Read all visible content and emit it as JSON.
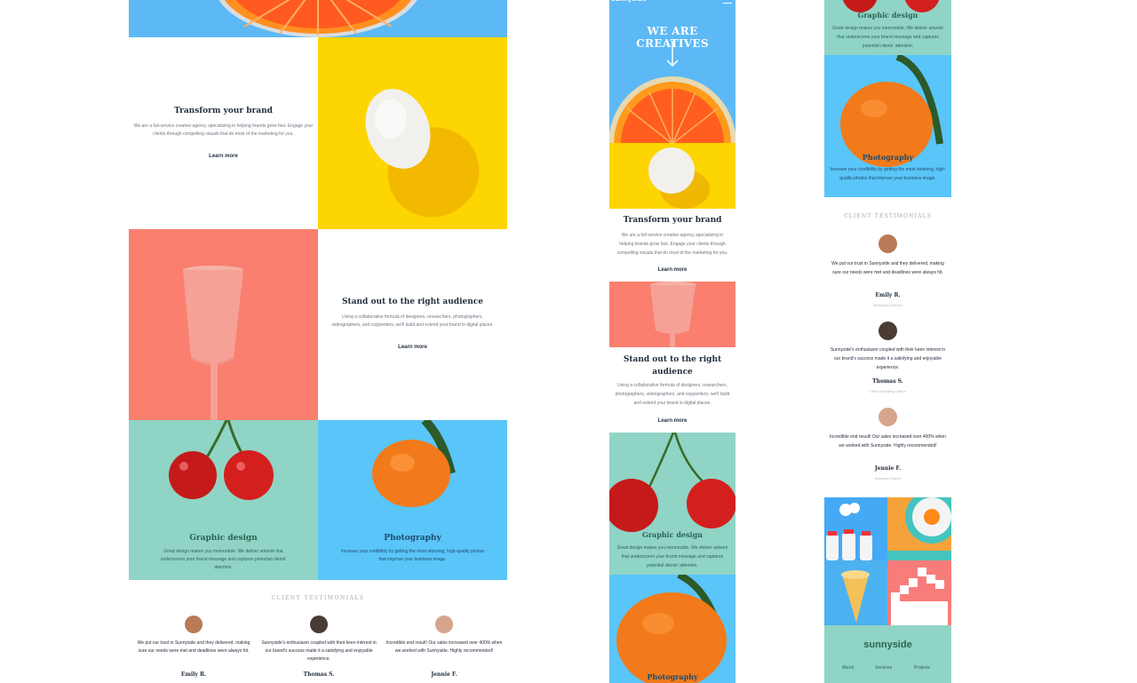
{
  "colors": {
    "sky": "#5cb9f6",
    "yellow": "#fdd500",
    "coral": "#fa7f6f",
    "mint": "#90d4c5",
    "blue": "#5ac5f8",
    "dark_text": "#24303e",
    "grey_text": "#6f7683"
  },
  "desktop": {
    "transform": {
      "title": "Transform your brand",
      "body": "We are a full-service creative agency specializing in helping brands grow fast. Engage your clients through compelling visuals that do most of the marketing for you.",
      "link": "Learn more"
    },
    "standout": {
      "title": "Stand out to the right audience",
      "body": "Using a collaborative formula of designers, researchers, photographers, videographers, and copywriters, we'll build and extend your brand in digital places.",
      "link": "Learn more"
    },
    "graphic": {
      "title": "Graphic design",
      "body": "Great design makes you memorable. We deliver artwork that underscores your brand message and captures potential clients' attention."
    },
    "photography": {
      "title": "Photography",
      "body": "Increase your credibility by getting the most stunning, high-quality photos that improve your business image."
    },
    "testimonials_heading": "CLIENT TESTIMONIALS",
    "testimonials": [
      {
        "quote": "We put our trust in Sunnyside and they delivered, making sure our needs were met and deadlines were always hit.",
        "name": "Emily R."
      },
      {
        "quote": "Sunnyside's enthusiasm coupled with their keen interest in our brand's success made it a satisfying and enjoyable experience.",
        "name": "Thomas S."
      },
      {
        "quote": "Incredible end result! Our sales increased over 400% when we worked with Sunnyside. Highly recommended!",
        "name": "Jennie F."
      }
    ]
  },
  "mobile": {
    "logo": "sunnyside",
    "hero_title": "WE ARE CREATIVES",
    "transform": {
      "title": "Transform your brand",
      "body": "We are a full-service creative agency specializing in helping brands grow fast. Engage your clients through compelling visuals that do most of the marketing for you.",
      "link": "Learn more"
    },
    "standout": {
      "title": "Stand out to the right audience",
      "body": "Using a collaborative formula of designers, researchers, photographers, videographers, and copywriters, we'll build and extend your brand in digital places.",
      "link": "Learn more"
    },
    "graphic": {
      "title": "Graphic design",
      "body": "Great design makes you memorable. We deliver artwork that underscores your brand message and captures potential clients' attention."
    },
    "photography": {
      "title": "Photography"
    }
  },
  "mobile2": {
    "graphic": {
      "title": "Graphic design",
      "body": "Great design makes you memorable. We deliver artwork that underscores your brand message and captures potential clients' attention."
    },
    "photography": {
      "title": "Photography",
      "body": "Increase your credibility by getting the most stunning, high-quality photos that improve your business image."
    },
    "testimonials_heading": "CLIENT TESTIMONIALS",
    "testimonials": [
      {
        "quote": "We put our trust in Sunnyside and they delivered, making sure our needs were met and deadlines were always hit.",
        "name": "Emily R.",
        "role": "Marketing Director"
      },
      {
        "quote": "Sunnyside's enthusiasm coupled with their keen interest in our brand's success made it a satisfying and enjoyable experience.",
        "name": "Thomas S.",
        "role": "Chief Operating Officer"
      },
      {
        "quote": "Incredible end result! Our sales increased over 400% when we worked with Sunnyside. Highly recommended!",
        "name": "Jennie F.",
        "role": "Business Owner"
      }
    ],
    "footer": {
      "logo": "sunnyside",
      "links": [
        "About",
        "Services",
        "Projects"
      ]
    }
  }
}
